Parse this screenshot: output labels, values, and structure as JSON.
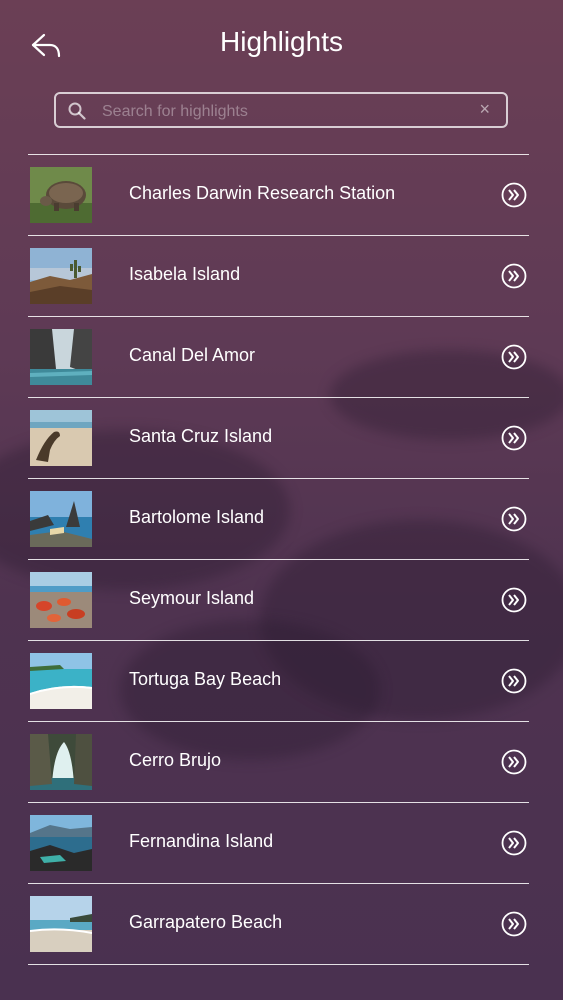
{
  "header": {
    "title": "Highlights",
    "back_icon": "back-arrow-icon"
  },
  "search": {
    "placeholder": "Search for highlights",
    "value": "",
    "clear_icon": "×"
  },
  "items": [
    {
      "label": "Charles Darwin Research Station",
      "thumb": "tortoise"
    },
    {
      "label": "Isabela Island",
      "thumb": "cactus-landscape"
    },
    {
      "label": "Canal Del Amor",
      "thumb": "canal-rocks"
    },
    {
      "label": "Santa Cruz Island",
      "thumb": "sea-lion-beach"
    },
    {
      "label": "Bartolome Island",
      "thumb": "pinnacle-rock"
    },
    {
      "label": "Seymour Island",
      "thumb": "red-crabs"
    },
    {
      "label": "Tortuga Bay Beach",
      "thumb": "white-beach"
    },
    {
      "label": "Cerro Brujo",
      "thumb": "rock-arch"
    },
    {
      "label": "Fernandina Island",
      "thumb": "lava-coast"
    },
    {
      "label": "Garrapatero Beach",
      "thumb": "sandy-beach"
    }
  ],
  "colors": {
    "background": "#5e3a55",
    "text": "#ffffff",
    "divider": "#ffffff"
  }
}
